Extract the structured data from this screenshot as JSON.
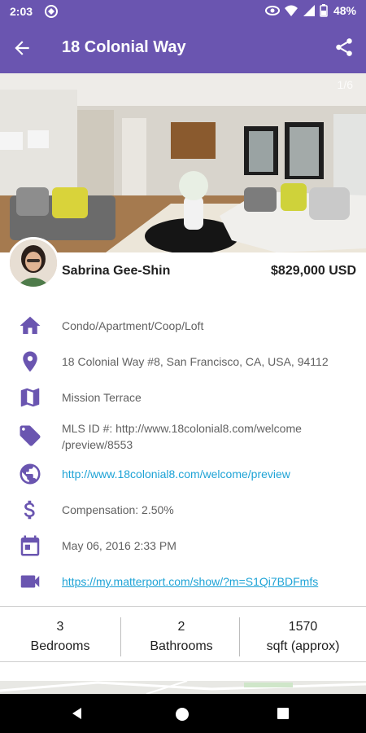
{
  "status": {
    "time": "2:03",
    "battery": "48%"
  },
  "appbar": {
    "title": "18 Colonial Way"
  },
  "gallery": {
    "counter": "1/6"
  },
  "agent": {
    "name": "Sabrina Gee-Shin",
    "price": "$829,000 USD"
  },
  "details": [
    {
      "icon": "home-icon",
      "text": "Condo/Apartment/Coop/Loft"
    },
    {
      "icon": "location-pin-icon",
      "text": "18 Colonial Way #8, San Francisco, CA, USA, 94112"
    },
    {
      "icon": "map-icon",
      "text": "Mission Terrace"
    },
    {
      "icon": "tag-icon",
      "line1": "MLS ID #: http://www.18colonial8.com/welcome",
      "line2": "/preview/8553"
    },
    {
      "icon": "globe-icon",
      "text": "http://www.18colonial8.com/welcome/preview"
    },
    {
      "icon": "dollar-icon",
      "text": "Compensation: 2.50%"
    },
    {
      "icon": "calendar-icon",
      "text": "May 06, 2016 2:33 PM"
    },
    {
      "icon": "video-icon",
      "text": "https://my.matterport.com/show/?m=S1Qi7BDFmfs"
    }
  ],
  "stats": [
    {
      "value": "3",
      "label": "Bedrooms"
    },
    {
      "value": "2",
      "label": "Bathrooms"
    },
    {
      "value": "1570",
      "label": "sqft (approx)"
    }
  ],
  "colors": {
    "primary": "#6a55b0",
    "link": "#1ea3d6",
    "icon": "#6a55b0"
  }
}
